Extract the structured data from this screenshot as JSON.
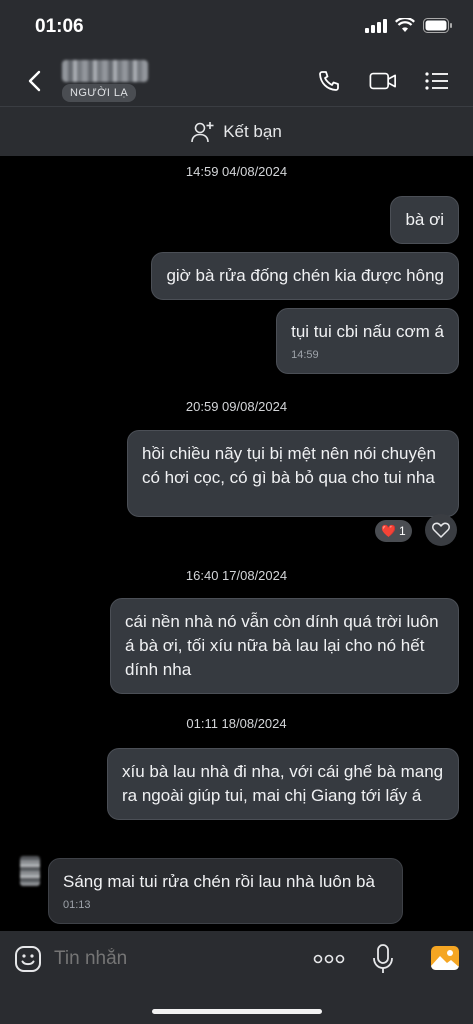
{
  "status_bar": {
    "time": "01:06"
  },
  "header": {
    "stranger_badge": "NGƯỜI LẠ"
  },
  "friend_bar": {
    "label": "Kết bạn"
  },
  "messages": [
    {
      "timestamp": "14:59 04/08/2024"
    },
    {
      "text": "bà ơi"
    },
    {
      "text": "giờ bà rửa đống chén kia được hông"
    },
    {
      "text": "tụi tui cbi nấu cơm á",
      "time": "14:59"
    },
    {
      "timestamp": "20:59 09/08/2024"
    },
    {
      "text": "hồi chiều nãy tụi bị mệt nên nói chuyện có hơi cọc, có gì bà bỏ qua cho tui nha",
      "reaction": "❤️",
      "reaction_count": "1"
    },
    {
      "timestamp": "16:40 17/08/2024"
    },
    {
      "text": "cái nền nhà nó vẫn còn dính quá trời luôn á bà ơi, tối xíu nữa bà lau lại cho nó hết dính nha"
    },
    {
      "timestamp": "01:11 18/08/2024"
    },
    {
      "text": "xíu bà lau nhà đi nha, với cái ghế bà mang ra ngoài giúp tui, mai chị Giang tới lấy á"
    },
    {
      "text": "Sáng mai tui rửa chén rồi lau nhà luôn bà",
      "time": "01:13"
    }
  ],
  "input": {
    "placeholder": "Tin nhắn"
  },
  "icons": {
    "back": "chevron-left-icon",
    "call": "phone-icon",
    "video": "video-camera-icon",
    "menu": "list-menu-icon",
    "add_friend": "add-user-icon",
    "emoji": "emoji-icon",
    "more": "more-dots-icon",
    "mic": "microphone-icon",
    "image": "image-icon"
  },
  "colors": {
    "accent_image": "#f5a623",
    "bubble_out": "#363a40",
    "background": "#000000"
  }
}
